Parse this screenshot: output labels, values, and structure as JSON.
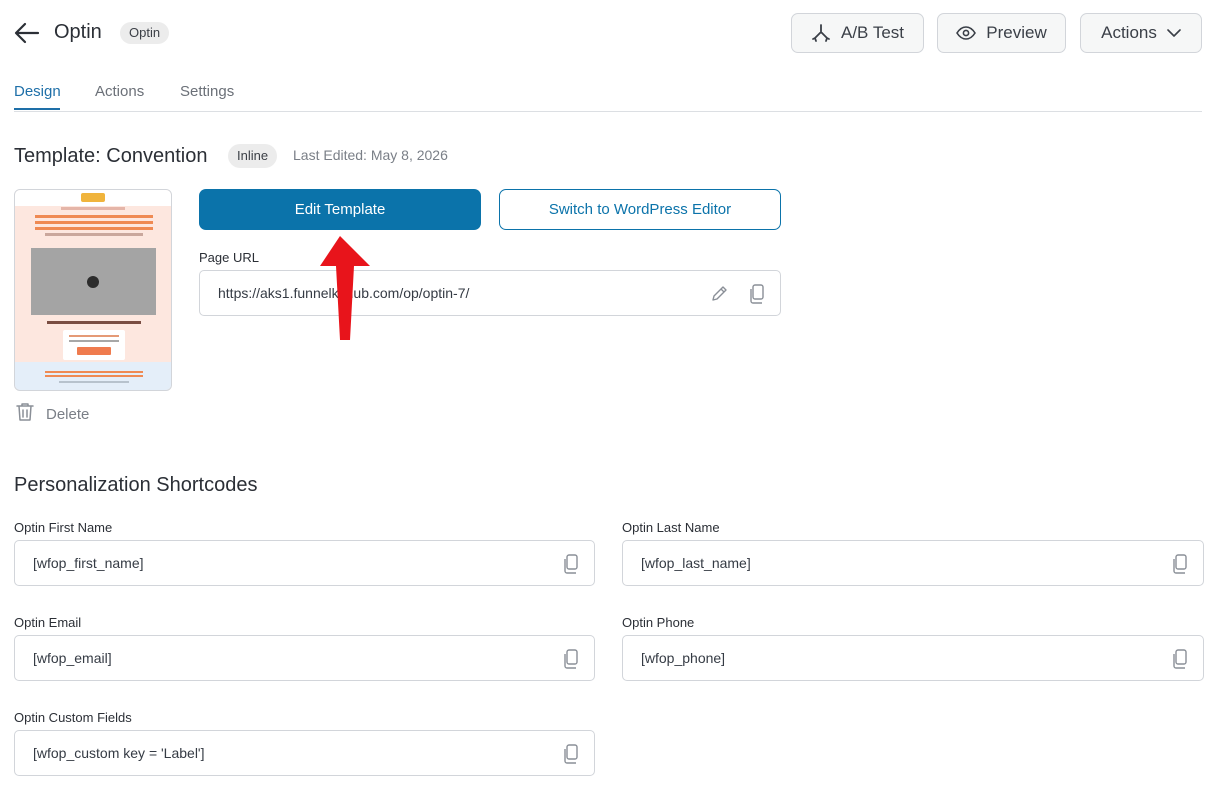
{
  "header": {
    "title": "Optin",
    "badge": "Optin",
    "ab_test_label": "A/B Test",
    "preview_label": "Preview",
    "actions_label": "Actions"
  },
  "tabs": [
    {
      "label": "Design",
      "active": true
    },
    {
      "label": "Actions",
      "active": false
    },
    {
      "label": "Settings",
      "active": false
    }
  ],
  "template": {
    "title": "Template: Convention",
    "type_badge": "Inline",
    "last_edited": "Last Edited: May 8, 2026",
    "delete_label": "Delete",
    "edit_button": "Edit Template",
    "switch_button": "Switch to WordPress Editor",
    "page_url_label": "Page URL",
    "page_url": "https://aks1.funnelkithub.com/op/optin-7/"
  },
  "shortcodes": {
    "title": "Personalization Shortcodes",
    "fields": [
      {
        "label": "Optin First Name",
        "value": "[wfop_first_name]"
      },
      {
        "label": "Optin Last Name",
        "value": "[wfop_last_name]"
      },
      {
        "label": "Optin Email",
        "value": "[wfop_email]"
      },
      {
        "label": "Optin Phone",
        "value": "[wfop_phone]"
      },
      {
        "label": "Optin Custom Fields",
        "value": "[wfop_custom key = 'Label']"
      }
    ]
  },
  "colors": {
    "primary": "#0b73aa",
    "tab_active": "#1e6fa8",
    "annotation_arrow": "#e8141b"
  },
  "icons": [
    "back-arrow-icon",
    "ab-test-icon",
    "eye-icon",
    "chevron-down-icon",
    "pencil-icon",
    "copy-icon",
    "trash-icon"
  ]
}
